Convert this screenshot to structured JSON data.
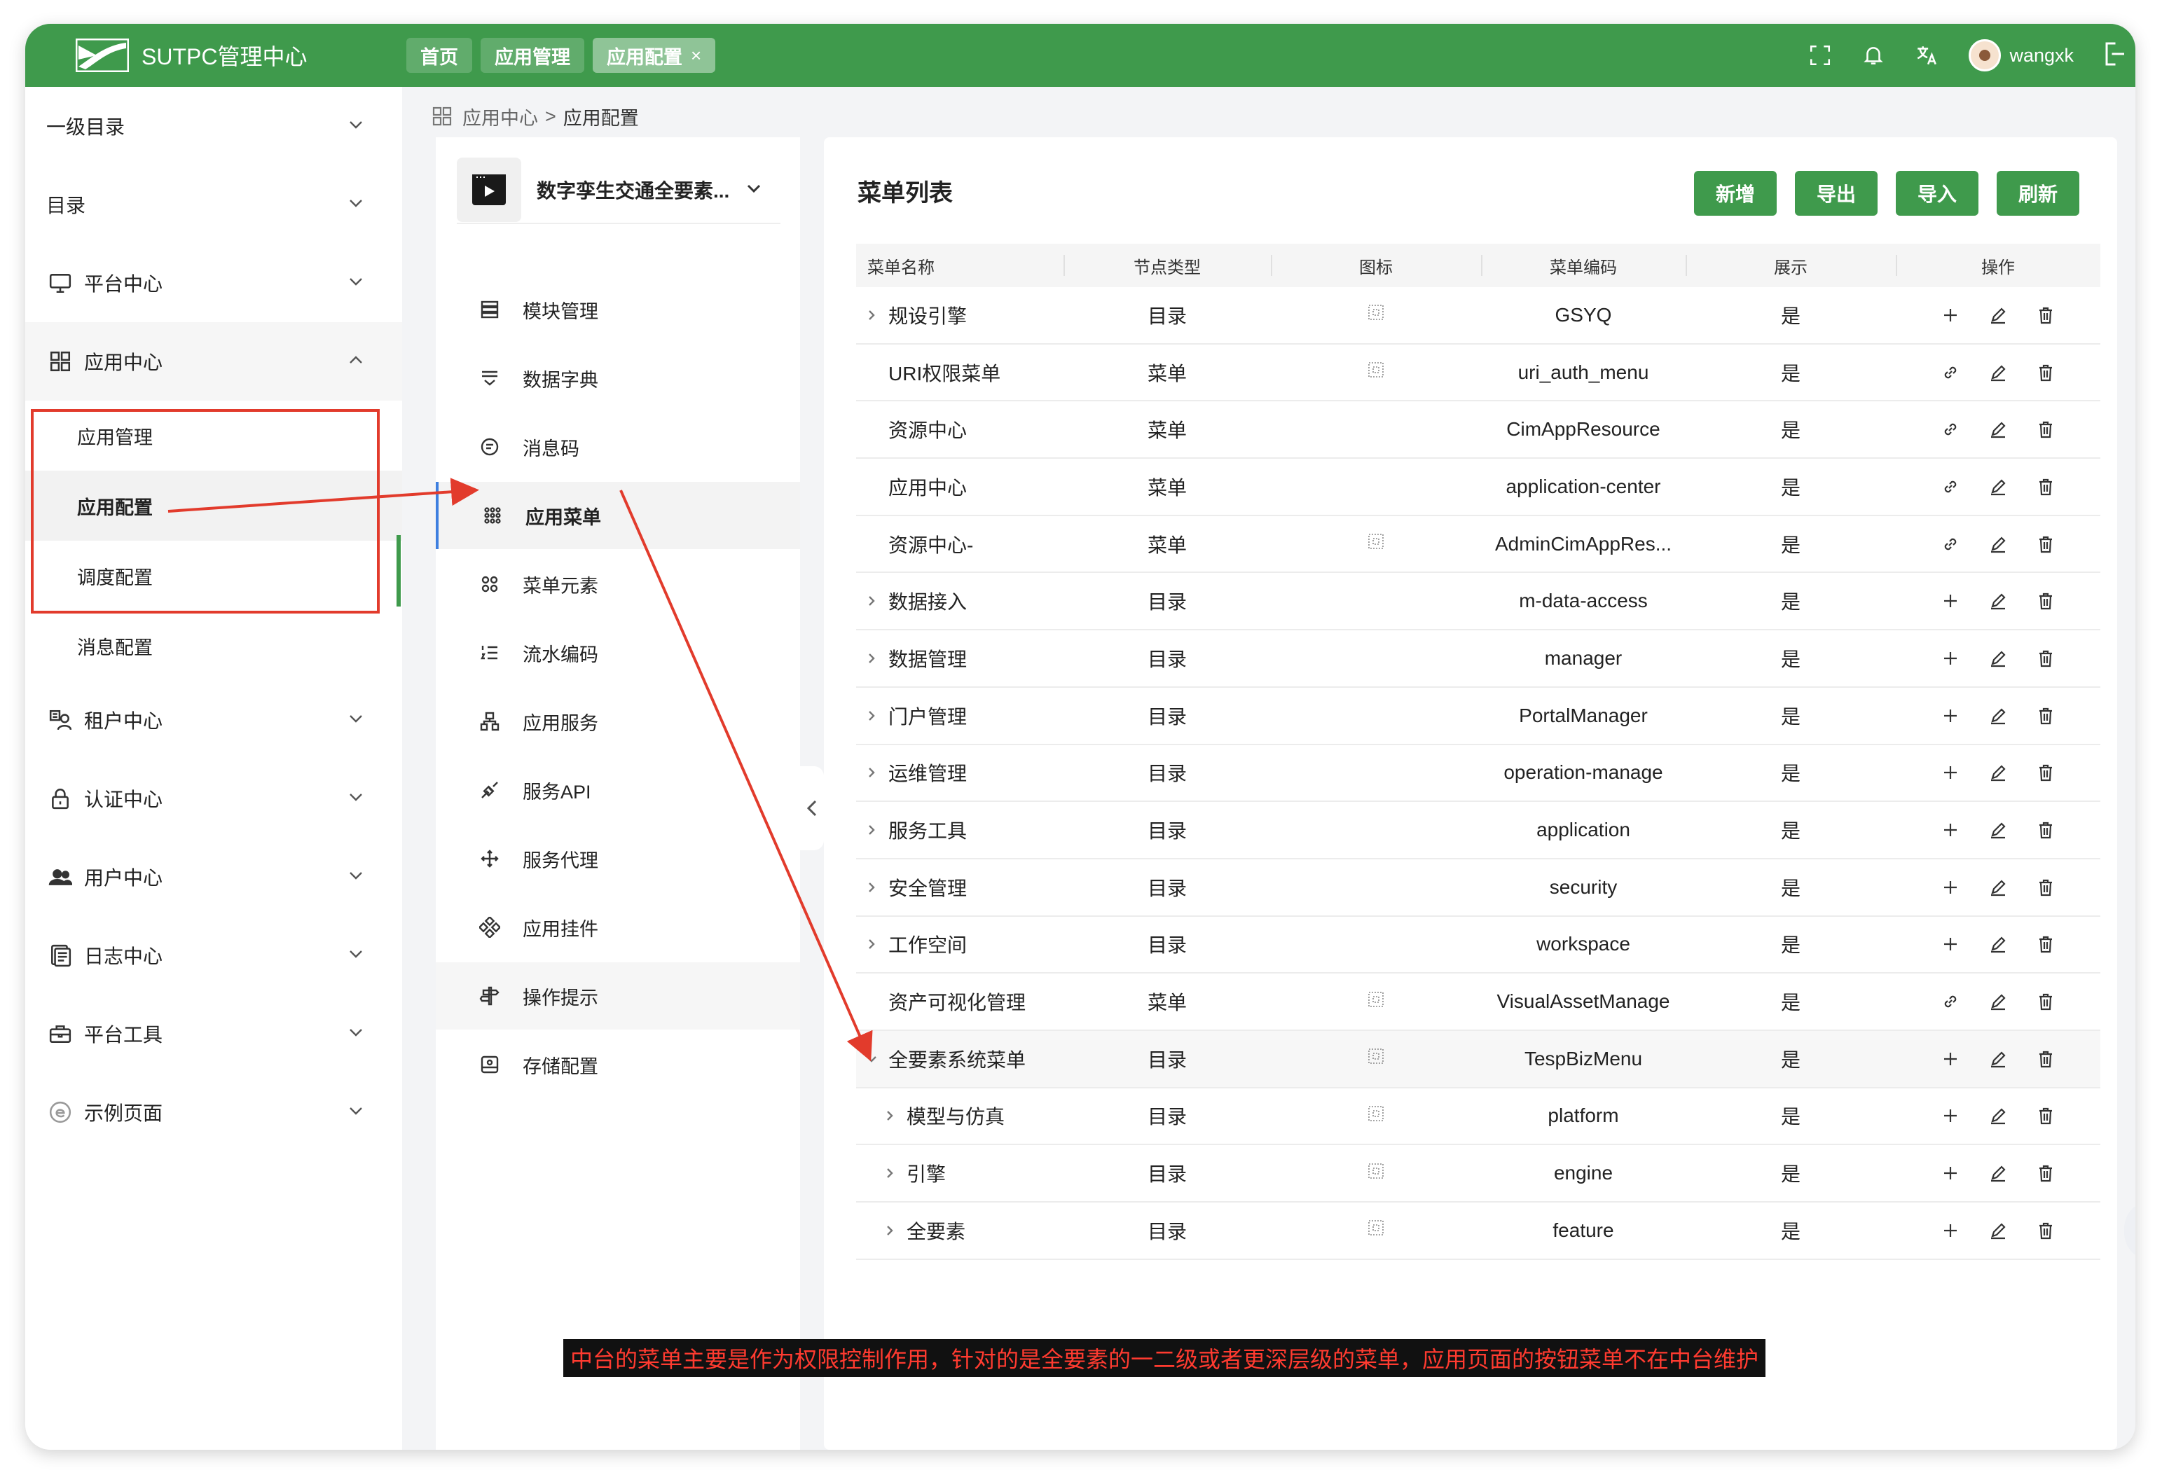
{
  "topbar": {
    "brand": "SUTPC管理中心",
    "tabs": [
      {
        "label": "首页",
        "active": false
      },
      {
        "label": "应用管理",
        "active": false
      },
      {
        "label": "应用配置",
        "active": true,
        "close": "×"
      }
    ],
    "username": "wangxk",
    "icons": [
      "fullscreen-icon",
      "bell-icon",
      "translate-icon",
      "logout-icon"
    ]
  },
  "sidebar": {
    "items": [
      {
        "label": "一级目录",
        "icon": ""
      },
      {
        "label": "目录",
        "icon": ""
      },
      {
        "label": "平台中心",
        "icon": "monitor-icon"
      },
      {
        "label": "应用中心",
        "icon": "grid-icon",
        "open": true
      },
      {
        "label": "租户中心",
        "icon": "tenant-icon"
      },
      {
        "label": "认证中心",
        "icon": "lock-icon"
      },
      {
        "label": "用户中心",
        "icon": "users-icon"
      },
      {
        "label": "日志中心",
        "icon": "log-icon"
      },
      {
        "label": "平台工具",
        "icon": "toolbox-icon"
      },
      {
        "label": "示例页面",
        "icon": "example-icon"
      }
    ],
    "sub_items": [
      {
        "label": "应用管理",
        "active": false
      },
      {
        "label": "应用配置",
        "active": true
      },
      {
        "label": "调度配置",
        "active": false
      },
      {
        "label": "消息配置",
        "active": false
      }
    ]
  },
  "breadcrumb": {
    "parent": "应用中心",
    "separator": ">",
    "current": "应用配置"
  },
  "app_selector": {
    "name": "数字孪生交通全要素..."
  },
  "config_menu": [
    {
      "label": "模块管理",
      "icon": "module-icon"
    },
    {
      "label": "数据字典",
      "icon": "dictionary-icon"
    },
    {
      "label": "消息码",
      "icon": "message-icon"
    },
    {
      "label": "应用菜单",
      "icon": "menu-dots-icon",
      "active": true
    },
    {
      "label": "菜单元素",
      "icon": "menu-element-icon"
    },
    {
      "label": "流水编码",
      "icon": "list-number-icon"
    },
    {
      "label": "应用服务",
      "icon": "service-icon"
    },
    {
      "label": "服务API",
      "icon": "api-icon"
    },
    {
      "label": "服务代理",
      "icon": "proxy-icon"
    },
    {
      "label": "应用挂件",
      "icon": "widget-icon"
    },
    {
      "label": "操作提示",
      "icon": "signpost-icon"
    },
    {
      "label": "存储配置",
      "icon": "storage-icon"
    }
  ],
  "menu_list": {
    "title": "菜单列表",
    "buttons": [
      "新增",
      "导出",
      "导入",
      "刷新"
    ],
    "columns": [
      "菜单名称",
      "节点类型",
      "图标",
      "菜单编码",
      "展示",
      "操作"
    ],
    "rows": [
      {
        "name": "规设引擎",
        "type": "目录",
        "has_icon": true,
        "code": "GSYQ",
        "show": "是",
        "expander": "right",
        "level": 0,
        "action": "add"
      },
      {
        "name": "URI权限菜单",
        "type": "菜单",
        "has_icon": true,
        "code": "uri_auth_menu",
        "show": "是",
        "expander": "",
        "level": 0,
        "action": "link"
      },
      {
        "name": "资源中心",
        "type": "菜单",
        "has_icon": false,
        "code": "CimAppResource",
        "show": "是",
        "expander": "",
        "level": 0,
        "action": "link"
      },
      {
        "name": "应用中心",
        "type": "菜单",
        "has_icon": false,
        "code": "application-center",
        "show": "是",
        "expander": "",
        "level": 0,
        "action": "link"
      },
      {
        "name": "资源中心-",
        "type": "菜单",
        "has_icon": true,
        "code": "AdminCimAppRes...",
        "show": "是",
        "expander": "",
        "level": 0,
        "action": "link"
      },
      {
        "name": "数据接入",
        "type": "目录",
        "has_icon": false,
        "code": "m-data-access",
        "show": "是",
        "expander": "right",
        "level": 0,
        "action": "add"
      },
      {
        "name": "数据管理",
        "type": "目录",
        "has_icon": false,
        "code": "manager",
        "show": "是",
        "expander": "right",
        "level": 0,
        "action": "add"
      },
      {
        "name": "门户管理",
        "type": "目录",
        "has_icon": false,
        "code": "PortalManager",
        "show": "是",
        "expander": "right",
        "level": 0,
        "action": "add"
      },
      {
        "name": "运维管理",
        "type": "目录",
        "has_icon": false,
        "code": "operation-manage",
        "show": "是",
        "expander": "right",
        "level": 0,
        "action": "add"
      },
      {
        "name": "服务工具",
        "type": "目录",
        "has_icon": false,
        "code": "application",
        "show": "是",
        "expander": "right",
        "level": 0,
        "action": "add"
      },
      {
        "name": "安全管理",
        "type": "目录",
        "has_icon": false,
        "code": "security",
        "show": "是",
        "expander": "right",
        "level": 0,
        "action": "add"
      },
      {
        "name": "工作空间",
        "type": "目录",
        "has_icon": false,
        "code": "workspace",
        "show": "是",
        "expander": "right",
        "level": 0,
        "action": "add"
      },
      {
        "name": "资产可视化管理",
        "type": "菜单",
        "has_icon": true,
        "code": "VisualAssetManage",
        "show": "是",
        "expander": "",
        "level": 0,
        "action": "link"
      },
      {
        "name": "全要素系统菜单",
        "type": "目录",
        "has_icon": true,
        "code": "TespBizMenu",
        "show": "是",
        "expander": "down",
        "level": 0,
        "action": "add",
        "highlight": true
      },
      {
        "name": "模型与仿真",
        "type": "目录",
        "has_icon": true,
        "code": "platform",
        "show": "是",
        "expander": "right",
        "level": 1,
        "action": "add"
      },
      {
        "name": "引擎",
        "type": "目录",
        "has_icon": true,
        "code": "engine",
        "show": "是",
        "expander": "right",
        "level": 1,
        "action": "add"
      },
      {
        "name": "全要素",
        "type": "目录",
        "has_icon": true,
        "code": "feature",
        "show": "是",
        "expander": "right",
        "level": 1,
        "action": "add"
      }
    ]
  },
  "annotation": {
    "text": "中台的菜单主要是作为权限控制作用，针对的是全要素的一二级或者更深层级的菜单，应用页面的按钮菜单不在中台维护"
  },
  "colors": {
    "primary": "#3f9a4c",
    "annotation": "#e23b2c",
    "active_indicator": "#3d7fe0"
  }
}
